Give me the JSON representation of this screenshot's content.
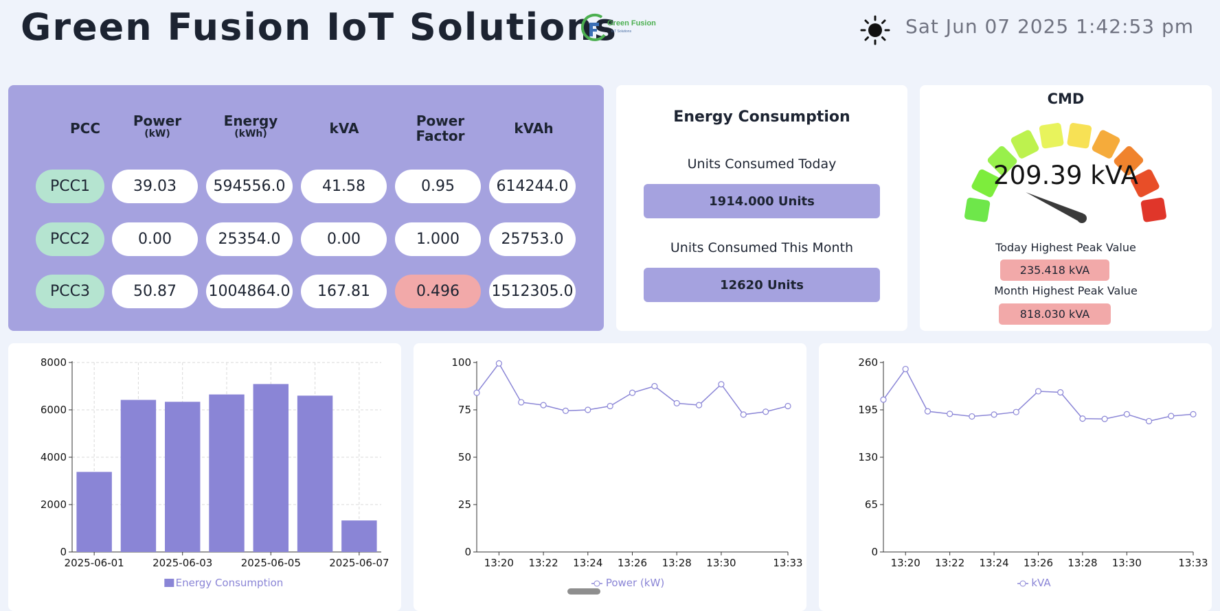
{
  "header": {
    "title": "Green Fusion IoT Solutions",
    "logo_text": "Green Fusion",
    "logo_subtext": "IoT Solutions",
    "datetime": "Sat Jun 07 2025 1:42:53 pm",
    "theme_icon": "sun-icon"
  },
  "pcc_table": {
    "headers": [
      {
        "main": "PCC",
        "sub": ""
      },
      {
        "main": "Power",
        "sub": "(kW)"
      },
      {
        "main": "Energy",
        "sub": "(kWh)"
      },
      {
        "main": "kVA",
        "sub": ""
      },
      {
        "main": "Power Factor",
        "sub": ""
      },
      {
        "main": "kVAh",
        "sub": ""
      }
    ],
    "rows": [
      [
        "PCC1",
        "39.03",
        "594556.0",
        "41.58",
        "0.95",
        "614244.0"
      ],
      [
        "PCC2",
        "0.00",
        "25354.0",
        "0.00",
        "1.000",
        "25753.0"
      ],
      [
        "PCC3",
        "50.87",
        "1004864.0",
        "167.81",
        "0.496",
        "1512305.0"
      ]
    ],
    "colors": {
      "panel": "#a5a2df",
      "pcc_pill": "#b5e4d0",
      "alert_pill": "#f2a9a9"
    }
  },
  "energy_consumption": {
    "title": "Energy Consumption",
    "today_label": "Units Consumed Today",
    "today_value": "1914.000 Units",
    "month_label": "Units Consumed This Month",
    "month_value": "12620 Units"
  },
  "cmd": {
    "title": "CMD",
    "value_text": "209.39 kVA",
    "gauge_fraction": 0.74,
    "segment_colors": [
      "#6ee74a",
      "#7ded3c",
      "#98f04b",
      "#bdf24e",
      "#e8f35c",
      "#f7e155",
      "#f5ab3b",
      "#f0832d",
      "#e84e28",
      "#e0362a"
    ],
    "today_peak_label": "Today Highest Peak Value",
    "today_peak_value": "235.418 kVA",
    "month_peak_label": "Month Highest Peak Value",
    "month_peak_value": "818.030 kVA"
  },
  "chart_data": [
    {
      "type": "bar",
      "categories": [
        "2025-06-01",
        "2025-06-02",
        "2025-06-03",
        "2025-06-04",
        "2025-06-05",
        "2025-06-06",
        "2025-06-07"
      ],
      "x_tick_labels": [
        "2025-06-01",
        "2025-06-03",
        "2025-06-05",
        "2025-06-07"
      ],
      "values": [
        3380,
        6420,
        6340,
        6650,
        7090,
        6600,
        1330
      ],
      "series": [
        {
          "name": "Energy Consumption",
          "values": [
            3380,
            6420,
            6340,
            6650,
            7090,
            6600,
            1330
          ]
        }
      ],
      "ylim": [
        0,
        8000
      ],
      "y_ticks": [
        0,
        2000,
        4000,
        6000,
        8000
      ],
      "grid": true,
      "legend": "bottom",
      "color": "#8a85d6"
    },
    {
      "type": "line",
      "x": [
        "13:19",
        "13:20",
        "13:21",
        "13:22",
        "13:23",
        "13:24",
        "13:25",
        "13:26",
        "13:27",
        "13:28",
        "13:29",
        "13:30",
        "13:31",
        "13:32",
        "13:33"
      ],
      "x_tick_labels": [
        "13:20",
        "13:22",
        "13:24",
        "13:26",
        "13:28",
        "13:30",
        "13:33"
      ],
      "series": [
        {
          "name": "Power (kW)",
          "values": [
            84,
            99.5,
            79,
            77.5,
            74.5,
            75,
            77,
            84,
            87.5,
            78.5,
            77.5,
            88.5,
            72.5,
            74,
            77
          ]
        }
      ],
      "ylim": [
        0,
        100
      ],
      "y_ticks": [
        0,
        25,
        50,
        75,
        100
      ],
      "legend": "bottom",
      "color": "#8a85d6"
    },
    {
      "type": "line",
      "x": [
        "13:19",
        "13:20",
        "13:21",
        "13:22",
        "13:23",
        "13:24",
        "13:25",
        "13:26",
        "13:27",
        "13:28",
        "13:29",
        "13:30",
        "13:31",
        "13:32",
        "13:33"
      ],
      "x_tick_labels": [
        "13:20",
        "13:22",
        "13:24",
        "13:26",
        "13:28",
        "13:30",
        "13:33"
      ],
      "series": [
        {
          "name": "kVA",
          "values": [
            209,
            251,
            193,
            189.5,
            186,
            188.5,
            192,
            220.5,
            219,
            183,
            182.5,
            189,
            179.5,
            186.5,
            189
          ]
        }
      ],
      "ylim": [
        0,
        260
      ],
      "y_ticks": [
        0,
        65,
        130,
        195,
        260
      ],
      "legend": "bottom",
      "color": "#8a85d6"
    }
  ]
}
